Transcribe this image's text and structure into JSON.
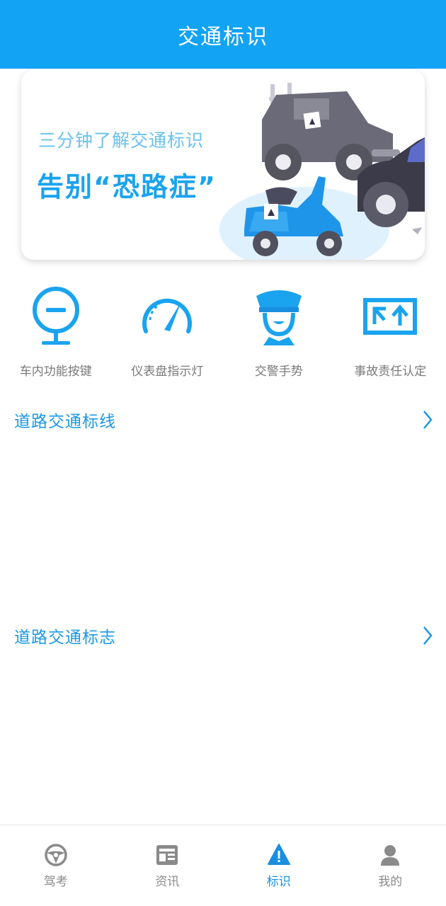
{
  "header": {
    "title": "交通标识"
  },
  "banner": {
    "subtitle": "三分钟了解交通标识",
    "headline": "告别“恐路症”"
  },
  "quick_items": [
    {
      "label": "车内功能按键",
      "icon": "steering-button-icon"
    },
    {
      "label": "仪表盘指示灯",
      "icon": "speedometer-icon"
    },
    {
      "label": "交警手势",
      "icon": "traffic-police-icon"
    },
    {
      "label": "事故责任认定",
      "icon": "accident-responsibility-icon"
    }
  ],
  "sections": [
    {
      "title": "道路交通标线"
    },
    {
      "title": "道路交通标志"
    }
  ],
  "tabbar": {
    "items": [
      {
        "label": "驾考",
        "icon": "steering-wheel-icon",
        "active": false
      },
      {
        "label": "资讯",
        "icon": "news-icon",
        "active": false
      },
      {
        "label": "标识",
        "icon": "warning-sign-icon",
        "active": true
      },
      {
        "label": "我的",
        "icon": "user-icon",
        "active": false
      }
    ]
  },
  "colors": {
    "primary": "#12a3f5",
    "accent": "#1a98e2",
    "inactive": "#8a8a8a"
  }
}
